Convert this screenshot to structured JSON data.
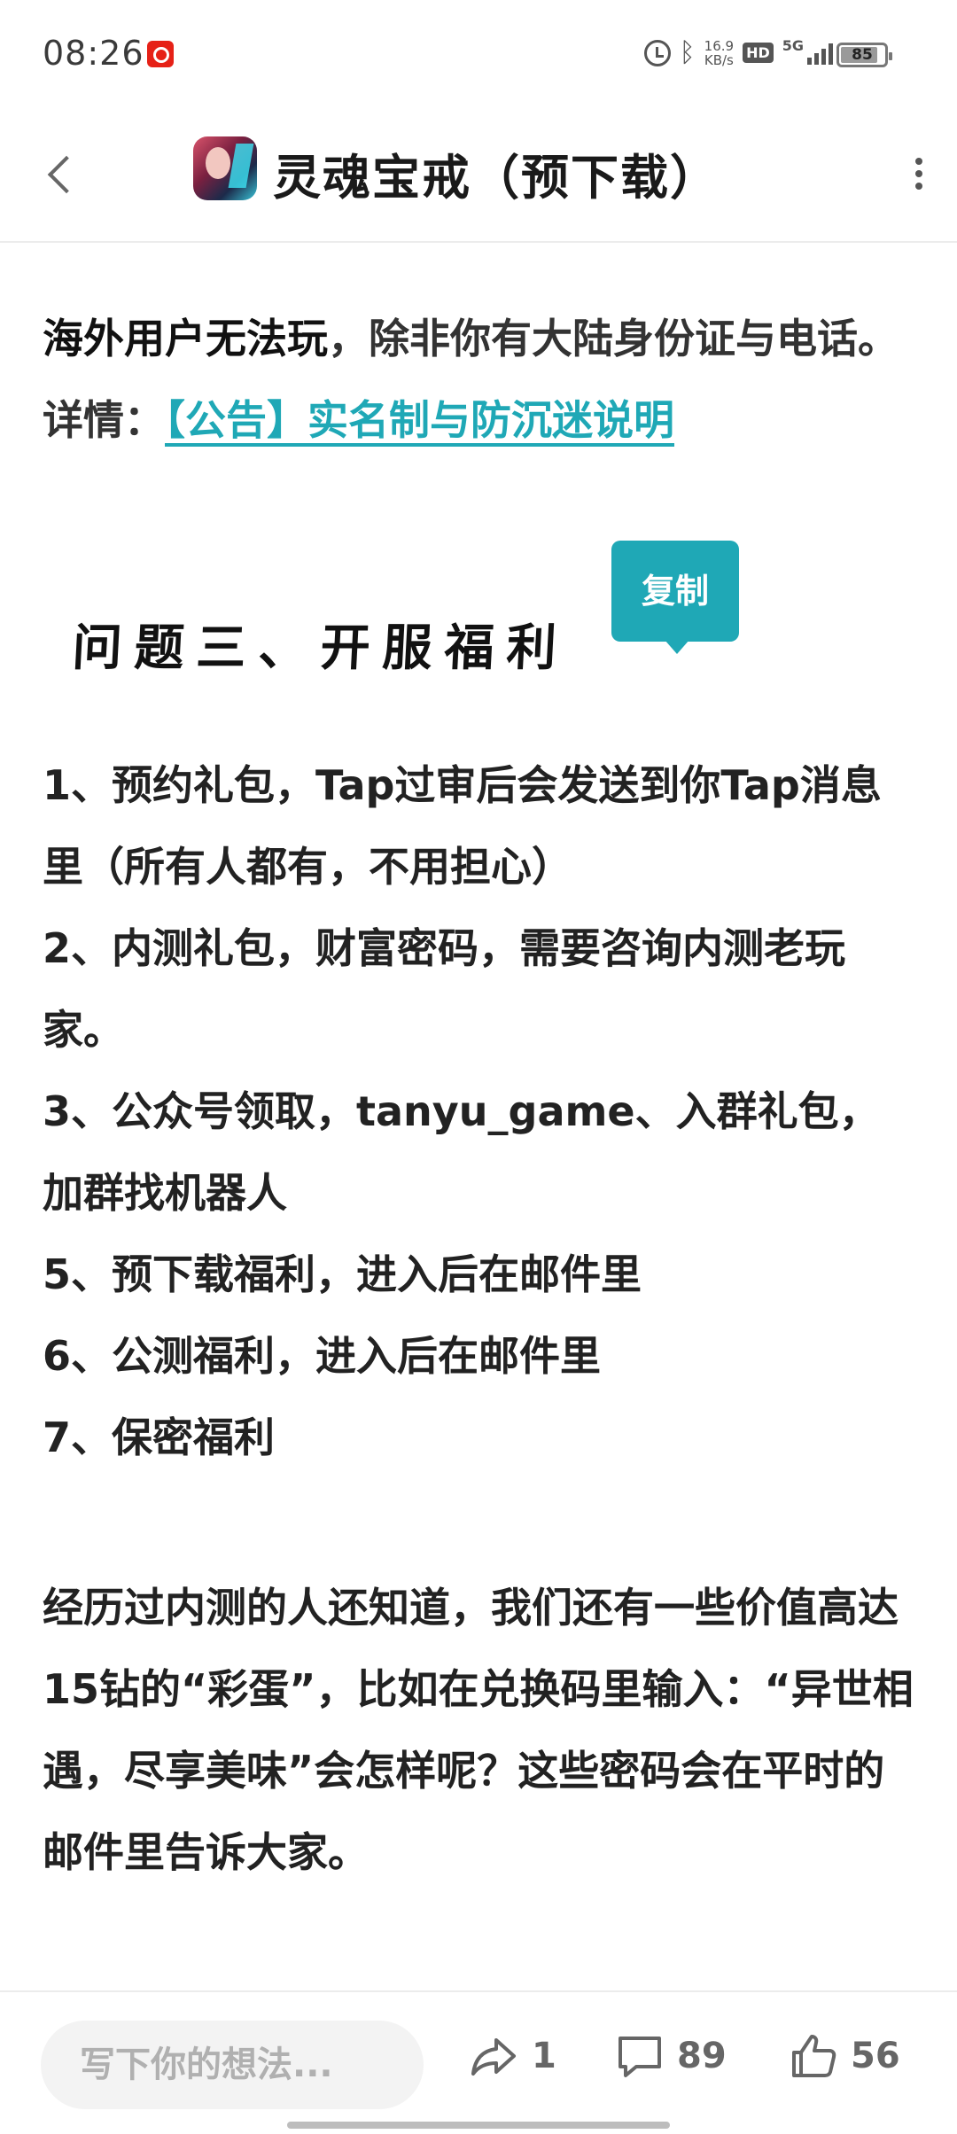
{
  "status_bar": {
    "time": "08:26",
    "speed_top": "16.9",
    "speed_bottom": "KB/s",
    "hd": "HD",
    "network": "5G",
    "battery": "85",
    "battery_level": 0.85
  },
  "nav": {
    "title": "灵魂宝戒（预下载）"
  },
  "notice": {
    "bold_text": "海外用户无法玩",
    "normal_text": "，除非你有大陆身份证与电话。详情：",
    "link_text": "【公告】实名制与防沉迷说明"
  },
  "heading": {
    "text": "问题三、开服福利"
  },
  "copy_button": {
    "label": "复制"
  },
  "benefits": [
    "1、预约礼包，Tap过审后会发送到你Tap消息里（所有人都有，不用担心）",
    "2、内测礼包，财富密码，需要咨询内测老玩家。",
    "3、公众号领取，tanyu_game、入群礼包，加群找机器人",
    "5、预下载福利，进入后在邮件里",
    "6、公测福利，进入后在邮件里",
    "7、保密福利"
  ],
  "paragraph": {
    "text": "经历过内测的人还知道，我们还有一些价值高达15钻的“彩蛋”，比如在兑换码里输入：“异世相遇，尽享美味”会怎样呢？这些密码会在平时的邮件里告诉大家。"
  },
  "bottom_bar": {
    "comment_placeholder": "写下你的想法...",
    "share_count": "1",
    "comment_count": "89",
    "like_count": "56"
  },
  "colors": {
    "accent": "#1fa8b6",
    "text": "#222222",
    "muted": "#666666"
  }
}
